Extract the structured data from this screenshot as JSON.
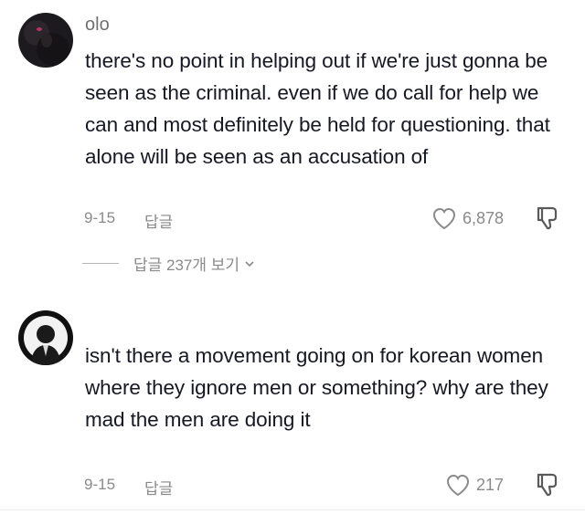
{
  "comments": [
    {
      "username": "olo",
      "text": "there's no point in helping out if we're just gonna be seen as the criminal. even if we do call for help we can and most definitely be held for questioning. that alone will be seen as an accusation of",
      "date": "9-15",
      "reply_label": "답글",
      "likes": "6,878",
      "view_replies": "답글 237개 보기"
    },
    {
      "username": "",
      "text": "isn't there a movement going on for korean women where they ignore men or something? why are they mad the men are doing it",
      "date": "9-15",
      "reply_label": "답글",
      "likes": "217"
    }
  ],
  "icons": {
    "like": "heart-icon",
    "dislike": "thumbs-down-icon",
    "expand": "chevron-down-icon"
  }
}
